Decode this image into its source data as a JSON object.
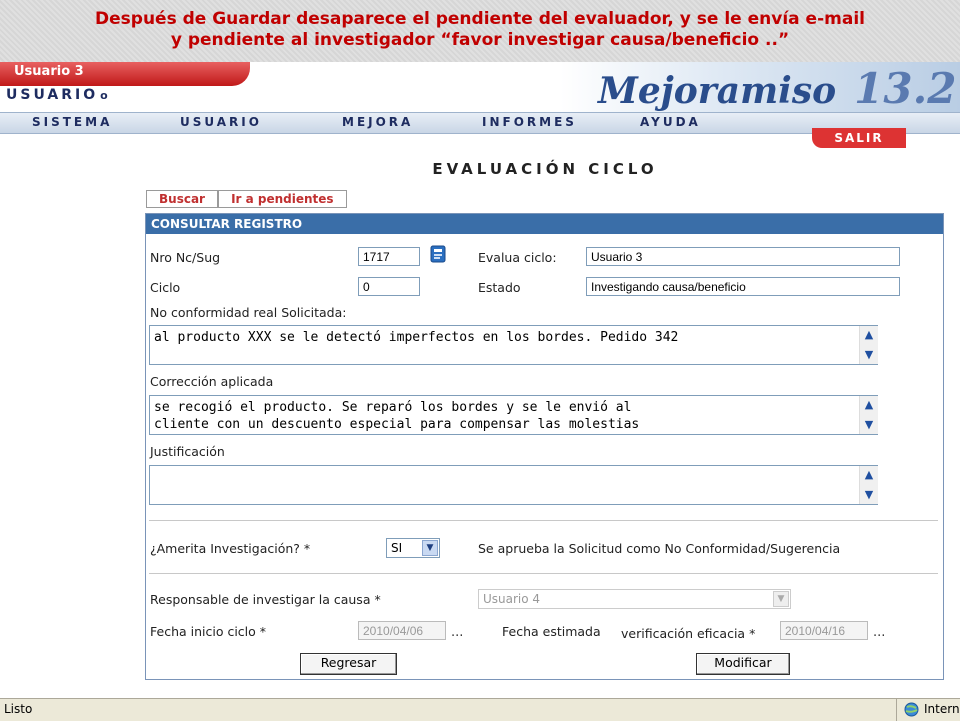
{
  "caption": {
    "line1": "Después de Guardar desaparece el pendiente del evaluador, y se le envía e-mail",
    "line2": "y pendiente al investigador “favor investigar causa/beneficio ..”"
  },
  "header": {
    "user_tab": "Usuario 3",
    "user_label": "USUARIO",
    "brand_name": "Mejoramiso",
    "brand_version": "13.2"
  },
  "menu": {
    "items": [
      "SISTEMA",
      "USUARIO",
      "MEJORA",
      "INFORMES",
      "AYUDA"
    ],
    "logout": "SALIR"
  },
  "page_title": "EVALUACIÓN CICLO",
  "tabs": [
    "Buscar",
    "Ir a pendientes"
  ],
  "panel": {
    "title": "CONSULTAR REGISTRO",
    "nro_label": "Nro Nc/Sug",
    "nro_value": "1717",
    "evalua_label": "Evalua ciclo:",
    "evalua_value": "Usuario 3",
    "ciclo_label": "Ciclo",
    "ciclo_value": "0",
    "estado_label": "Estado",
    "estado_value": "Investigando causa/beneficio",
    "nc_label": "No conformidad real Solicitada:",
    "nc_value": "al producto XXX se le detectó imperfectos en los bordes. Pedido 342",
    "correccion_label": "Corrección aplicada",
    "correccion_value": "se recogió el producto. Se reparó los bordes y se le envió al\ncliente con un descuento especial para compensar las molestias",
    "justificacion_label": "Justificación",
    "justificacion_value": "",
    "amerita_label": "¿Amerita Investigación? *",
    "amerita_value": "SI",
    "amerita_note": "Se aprueba la Solicitud como No Conformidad/Sugerencia",
    "responsable_label": "Responsable de investigar la causa *",
    "responsable_value": "Usuario 4",
    "fecha_inicio_label": "Fecha inicio ciclo *",
    "fecha_inicio_value": "2010/04/06",
    "fecha_estimada_label": "Fecha estimada",
    "verificacion_label": "verificación eficacia *",
    "fecha_estimada_value": "2010/04/16",
    "dots": "...",
    "regresar": "Regresar",
    "modificar": "Modificar"
  },
  "status": {
    "text": "Listo",
    "zone": "Intern"
  },
  "colors": {
    "caption_text": "#c00000",
    "panel_header": "#3a6ea8",
    "tab_text": "#c03030",
    "brand": "#2a4d8c"
  }
}
